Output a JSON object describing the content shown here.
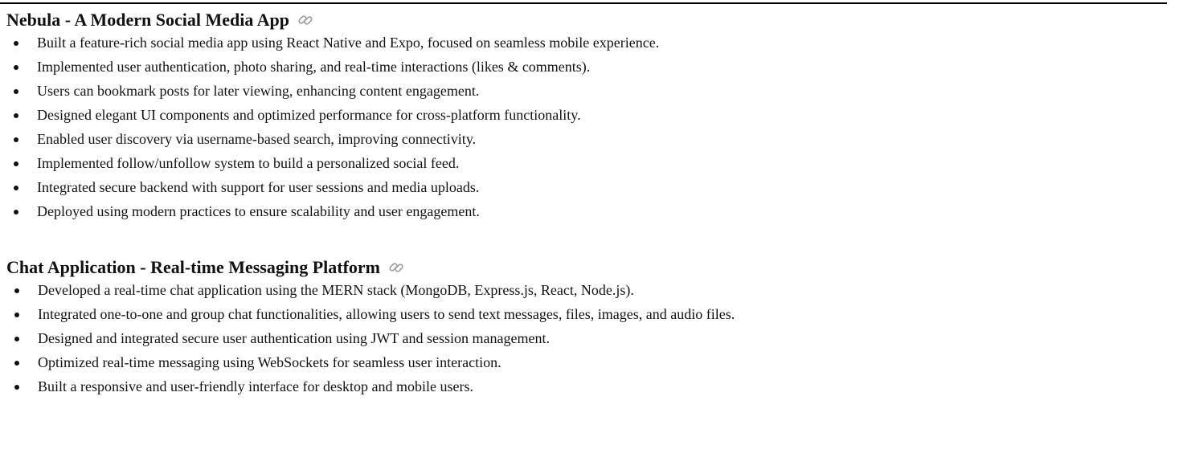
{
  "projects": [
    {
      "title": "Nebula - A Modern Social Media App",
      "link_icon": "link-icon",
      "bullets": [
        "Built a feature-rich social media app using React Native and Expo, focused on seamless mobile experience.",
        "Implemented user authentication, photo sharing, and real-time interactions (likes & comments).",
        "Users can bookmark posts for later viewing, enhancing content engagement.",
        "Designed elegant UI components and optimized performance for cross-platform functionality.",
        "Enabled user discovery via username-based search, improving connectivity.",
        "Implemented follow/unfollow system to build a personalized social feed.",
        "Integrated secure backend with support for user sessions and media uploads.",
        "Deployed using modern practices to ensure scalability and user engagement."
      ]
    },
    {
      "title": "Chat Application - Real-time Messaging Platform",
      "link_icon": "link-icon",
      "bullets": [
        "Developed a real-time chat application using the MERN stack (MongoDB, Express.js, React, Node.js).",
        "Integrated one-to-one and group chat functionalities, allowing users to send text messages, files, images, and audio files.",
        "Designed and integrated secure user authentication using JWT and session management.",
        "Optimized real-time messaging using WebSockets for seamless user interaction.",
        "Built a responsive and user-friendly interface for desktop and mobile users."
      ]
    }
  ],
  "colors": {
    "text": "#111111",
    "rule": "#000000",
    "link_icon": "#9a9a9a"
  }
}
